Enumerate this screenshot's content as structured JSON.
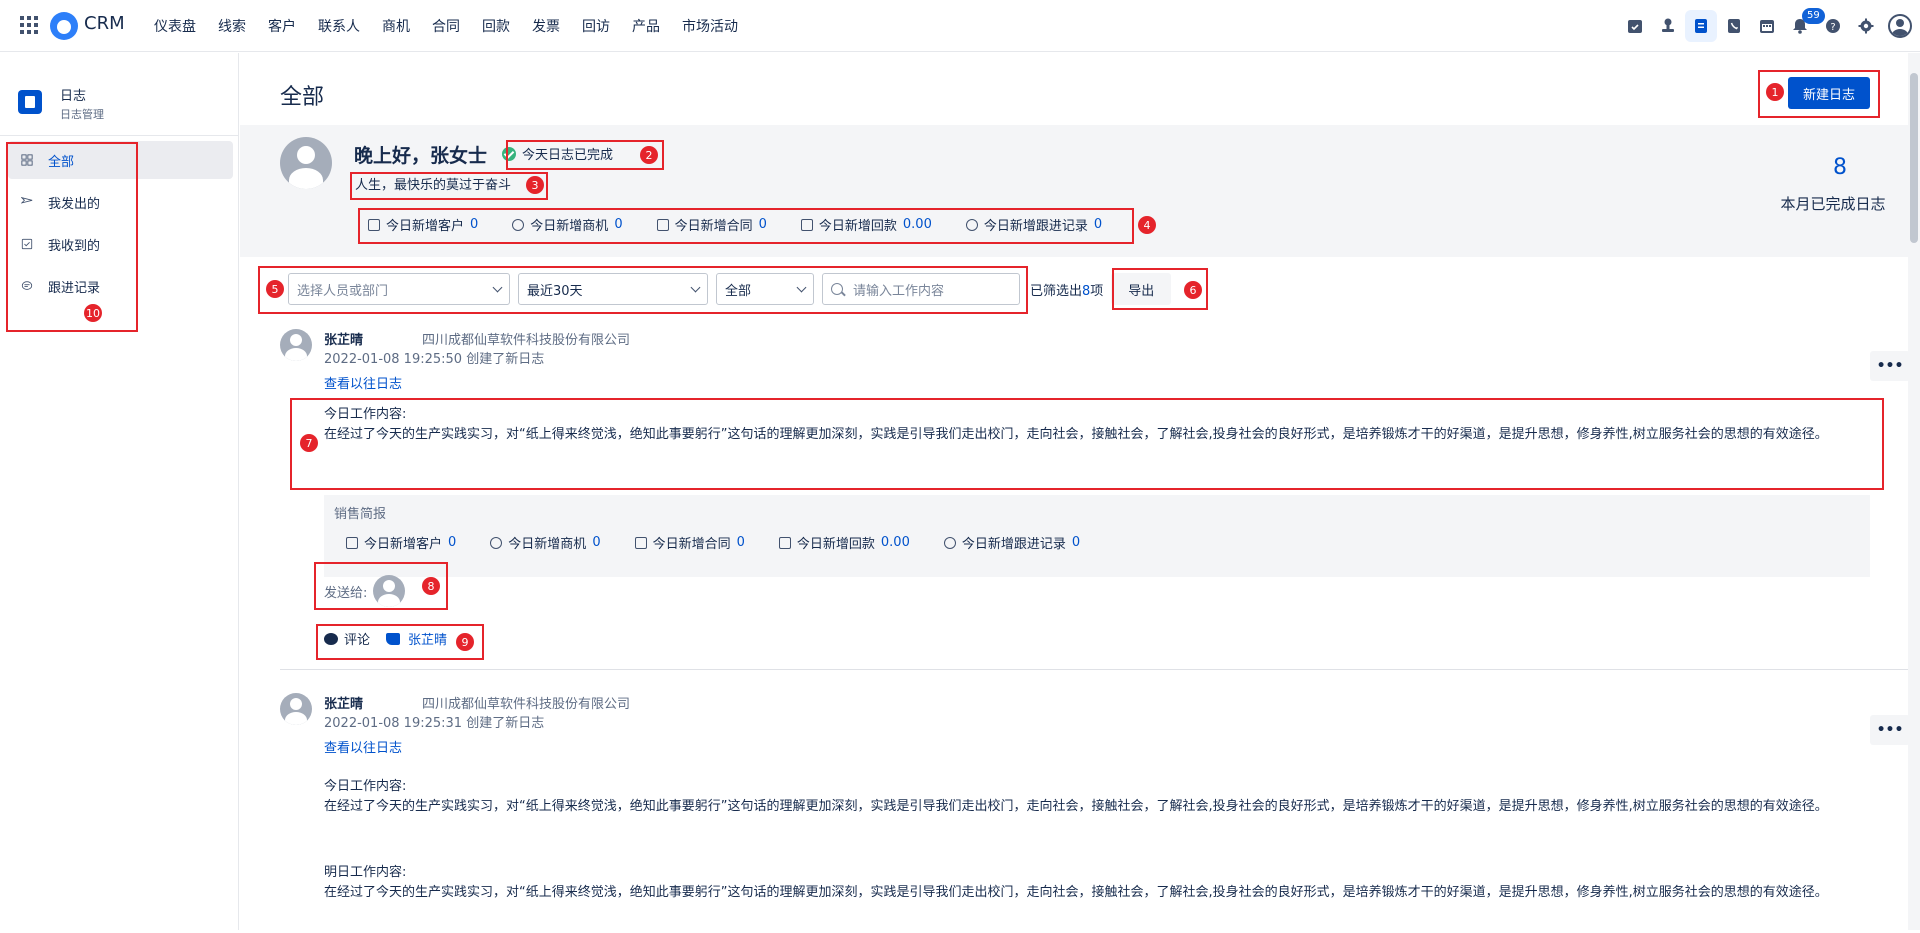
{
  "topbar": {
    "brand": "CRM",
    "nav": [
      "仪表盘",
      "线索",
      "客户",
      "联系人",
      "商机",
      "合同",
      "回款",
      "发票",
      "回访",
      "产品",
      "市场活动"
    ],
    "notification_count": "59"
  },
  "sidebar": {
    "title": "日志",
    "subtitle": "日志管理",
    "items": [
      {
        "label": "全部"
      },
      {
        "label": "我发出的"
      },
      {
        "label": "我收到的"
      },
      {
        "label": "跟进记录"
      }
    ]
  },
  "main": {
    "title": "全部",
    "new_button": "新建日志",
    "greeting": "晚上好，张女士",
    "done_tag": "今天日志已完成",
    "motto": "人生，最快乐的莫过于奋斗",
    "stats": [
      {
        "label": "今日新增客户",
        "value": "0"
      },
      {
        "label": "今日新增商机",
        "value": "0"
      },
      {
        "label": "今日新增合同",
        "value": "0"
      },
      {
        "label": "今日新增回款",
        "value": "0.00"
      },
      {
        "label": "今日新增跟进记录",
        "value": "0"
      }
    ],
    "month_count": "8",
    "month_label": "本月已完成日志"
  },
  "filters": {
    "person_placeholder": "选择人员或部门",
    "range": "最近30天",
    "type": "全部",
    "search_placeholder": "请输入工作内容",
    "count_prefix": "已筛选出",
    "count": "8",
    "count_suffix": "项",
    "export_label": "导出"
  },
  "entries": [
    {
      "name": "张芷晴",
      "company": "四川成都仙草软件科技股份有限公司",
      "meta": "2022-01-08 19:25:50  创建了新日志",
      "link": "查看以往日志",
      "today_label": "今日工作内容:",
      "today_text": "在经过了今天的生产实践实习，对“纸上得来终觉浅，绝知此事要躬行”这句话的理解更加深刻，实践是引导我们走出校门，走向社会，接触社会，了解社会,投身社会的良好形式，是培养锻炼才干的好渠道，是提升思想，修身养性,树立服务社会的思想的有效途径。",
      "report_title": "销售简报",
      "report_stats": [
        {
          "label": "今日新增客户",
          "value": "0"
        },
        {
          "label": "今日新增商机",
          "value": "0"
        },
        {
          "label": "今日新增合同",
          "value": "0"
        },
        {
          "label": "今日新增回款",
          "value": "0.00"
        },
        {
          "label": "今日新增跟进记录",
          "value": "0"
        }
      ],
      "send_label": "发送给:",
      "comment_label": "评论",
      "like_name": "张芷晴"
    },
    {
      "name": "张芷晴",
      "company": "四川成都仙草软件科技股份有限公司",
      "meta": "2022-01-08 19:25:31  创建了新日志",
      "link": "查看以往日志",
      "today_label": "今日工作内容:",
      "today_text": "在经过了今天的生产实践实习，对“纸上得来终觉浅，绝知此事要躬行”这句话的理解更加深刻，实践是引导我们走出校门，走向社会，接触社会，了解社会,投身社会的良好形式，是培养锻炼才干的好渠道，是提升思想，修身养性,树立服务社会的思想的有效途径。",
      "tomorrow_label": "明日工作内容:",
      "tomorrow_text": "在经过了今天的生产实践实习，对“纸上得来终觉浅，绝知此事要躬行”这句话的理解更加深刻，实践是引导我们走出校门，走向社会，接触社会，了解社会,投身社会的良好形式，是培养锻炼才干的好渠道，是提升思想，修身养性,树立服务社会的思想的有效途径。"
    }
  ],
  "annotations": [
    "1",
    "2",
    "3",
    "4",
    "5",
    "6",
    "7",
    "8",
    "9",
    "10"
  ]
}
